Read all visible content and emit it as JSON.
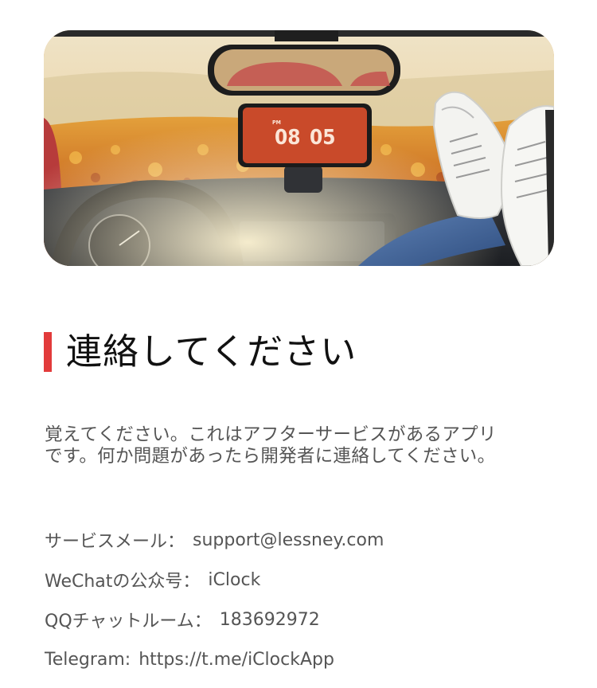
{
  "hero": {
    "clock_meridiem": "PM",
    "clock_hour": "08",
    "clock_minute": "05"
  },
  "heading": "連絡してください",
  "description": {
    "line1": "覚えてください。これはアフターサービスがあるアプリ",
    "line2": "です。何か問題があったら開発者に連絡してください。"
  },
  "contacts": [
    {
      "label": "サービスメール：",
      "value": "support@lessney.com"
    },
    {
      "label": "WeChatの公众号：",
      "value": "iClock"
    },
    {
      "label": "QQチャットルーム：",
      "value": "183692972"
    },
    {
      "label": "Telegram:",
      "value": "https://t.me/iClockApp"
    }
  ],
  "colors": {
    "accent_bar": "#e23b3b",
    "clock_screen": "#c94a2a",
    "body_text": "#555555"
  }
}
